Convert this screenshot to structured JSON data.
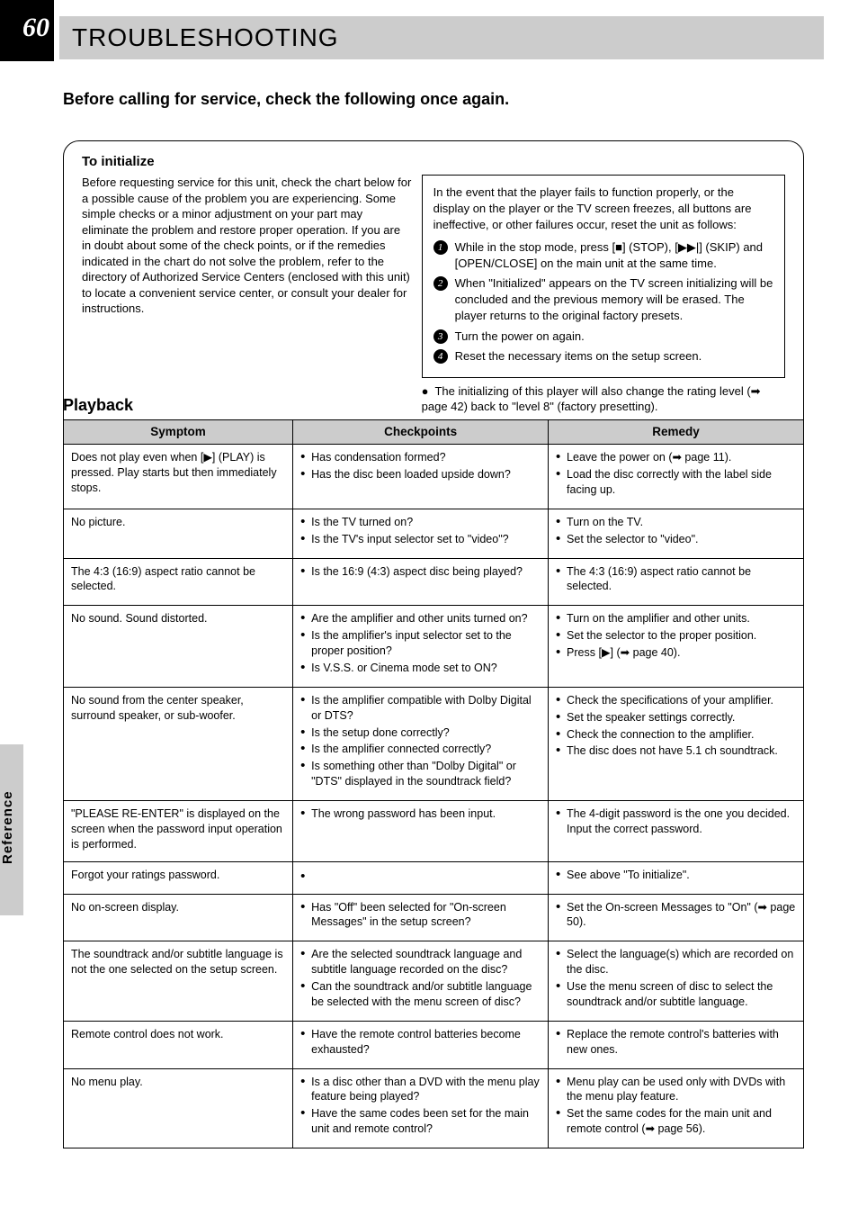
{
  "page_number": "60",
  "title": "TROUBLESHOOTING",
  "sections": {
    "initialize": {
      "boxTitle": "To initialize",
      "intro": "Before requesting service for this unit, check the chart below for a possible cause of the problem you are experiencing. Some simple checks or a minor adjustment on your part may eliminate the problem and restore proper operation.\nIf you are in doubt about some of the check points, or if the remedies indicated in the chart do not solve the problem, refer to the directory of Authorized Service Centers (enclosed with this unit) to locate a convenient service center, or consult your dealer for instructions.",
      "right_intro": "In the event that the player fails to function properly, or the display on the player or the TV screen freezes, all buttons are ineffective, or other failures occur, reset the unit as follows:",
      "steps": {
        "s1": "While in the stop mode, press [■] (STOP), [▶▶|] (SKIP) and [OPEN/CLOSE] on the main unit at the same time.",
        "s2": "When \"Initialized\" appears on the TV screen initializing will be concluded and the previous memory will be erased. The player returns to the original factory presets.",
        "s3": "Turn the power on again.",
        "s4": "Reset the necessary items on the setup screen."
      },
      "note": "The initializing of this player will also change the rating level (➡ page 42) back to \"level 8\" (factory presetting)."
    },
    "playback": {
      "header": {
        "symptom": "Symptom",
        "checkpoints": "Checkpoints",
        "remedy": "Remedy"
      },
      "rows": [
        {
          "symptom": "Does not play even when [▶] (PLAY) is pressed.\nPlay starts but then immediately stops.",
          "checks": [
            "Has condensation formed?",
            "Has the disc been loaded upside down?"
          ],
          "remedies": [
            "Leave the power on (➡ page 11).",
            "Load the disc correctly with the label side facing up."
          ]
        },
        {
          "symptom": "No picture.",
          "checks": [
            "Is the TV turned on?",
            "Is the TV's input selector set to \"video\"?"
          ],
          "remedies": [
            "Turn on the TV.",
            "Set the selector to \"video\"."
          ]
        },
        {
          "symptom": "The 4:3 (16:9) aspect ratio cannot be selected.",
          "checks": [
            "Is the 16:9 (4:3) aspect disc being played?"
          ],
          "remedies": [
            "The 4:3 (16:9) aspect ratio cannot be selected."
          ]
        },
        {
          "symptom": "No sound.\nSound distorted.",
          "checks": [
            "Are the amplifier and other units turned on?",
            "Is the amplifier's input selector set to the proper position?",
            "Is V.S.S. or Cinema mode set to ON?"
          ],
          "remedies": [
            "Turn on the amplifier and other units.",
            "Set the selector to the proper position.",
            "Press [▶] (➡ page 40)."
          ]
        },
        {
          "symptom": "No sound from the center speaker, surround speaker, or sub-woofer.",
          "checks": [
            "Is the amplifier compatible with Dolby Digital or DTS?",
            "Is the setup done correctly?",
            "Is the amplifier connected correctly?",
            "Is something other than \"Dolby Digital\" or \"DTS\" displayed in the soundtrack field?"
          ],
          "remedies": [
            "Check the specifications of your amplifier.",
            "Set the speaker settings correctly.",
            "Check the connection to the amplifier.",
            "The disc does not have 5.1 ch soundtrack."
          ]
        },
        {
          "symptom": "\"PLEASE RE-ENTER\" is displayed on the screen when the password input operation is performed.",
          "checks": [
            "The wrong password has been input."
          ],
          "remedies": [
            "The 4-digit password is the one you decided. Input the correct password."
          ]
        },
        {
          "symptom": "Forgot your ratings password.",
          "checks": [
            " "
          ],
          "remedies": [
            "See above \"To initialize\"."
          ]
        },
        {
          "symptom": "No on-screen display.",
          "checks": [
            "Has \"Off\" been selected for \"On-screen Messages\" in the setup screen?"
          ],
          "remedies": [
            "Set the On-screen Messages to \"On\" (➡ page 50)."
          ]
        },
        {
          "symptom": "The soundtrack and/or subtitle language is not the one selected on the setup screen.",
          "checks": [
            "Are the selected soundtrack language and subtitle language recorded on the disc?",
            "Can the soundtrack and/or subtitle language be selected with the menu screen of disc?"
          ],
          "remedies": [
            "Select the language(s) which are recorded on the disc.",
            "Use the menu screen of disc to select the soundtrack and/or subtitle language."
          ]
        },
        {
          "symptom": "Remote control does not work.",
          "checks": [
            "Have the remote control batteries become exhausted?"
          ],
          "remedies": [
            "Replace the remote control's batteries with new ones."
          ]
        },
        {
          "symptom": "No menu play.",
          "checks": [
            "Is a disc other than a DVD with the menu play feature being played?",
            "Have the same codes been set for the main unit and remote control?"
          ],
          "remedies": [
            "Menu play can be used only with DVDs with the menu play feature.",
            "Set the same codes for the main unit and remote control (➡ page 56)."
          ]
        }
      ]
    }
  },
  "sidetab": "Reference"
}
